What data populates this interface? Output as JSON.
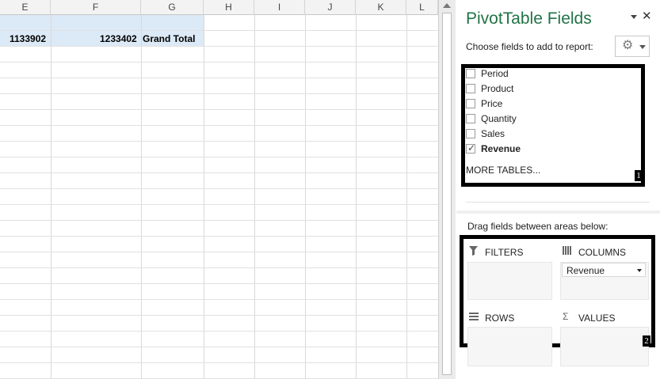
{
  "sheet": {
    "columns": [
      "E",
      "F",
      "G",
      "H",
      "I",
      "J",
      "K",
      "L"
    ],
    "cells": {
      "e_value": "1133902",
      "f_value": "1233402",
      "g_value": "Grand Total"
    }
  },
  "pivot_pane": {
    "title": "PivotTable Fields",
    "close_glyph": "✕",
    "choose_label": "Choose fields to add to report:",
    "fields": [
      {
        "label": "Period",
        "checked": false
      },
      {
        "label": "Product",
        "checked": false
      },
      {
        "label": "Price",
        "checked": false
      },
      {
        "label": "Quantity",
        "checked": false
      },
      {
        "label": "Sales",
        "checked": false
      },
      {
        "label": "Revenue",
        "checked": true
      }
    ],
    "more_tables": "MORE TABLES...",
    "drag_label": "Drag fields between areas below:",
    "areas": {
      "filters": "FILTERS",
      "columns": "COLUMNS",
      "rows": "ROWS",
      "values": "VALUES"
    },
    "columns_field": "Revenue",
    "badges": [
      "1",
      "2"
    ],
    "icons": {
      "filters": "filter-icon",
      "columns": "columns-icon",
      "rows": "rows-icon",
      "values": "sigma-icon",
      "settings": "gear-icon"
    }
  }
}
